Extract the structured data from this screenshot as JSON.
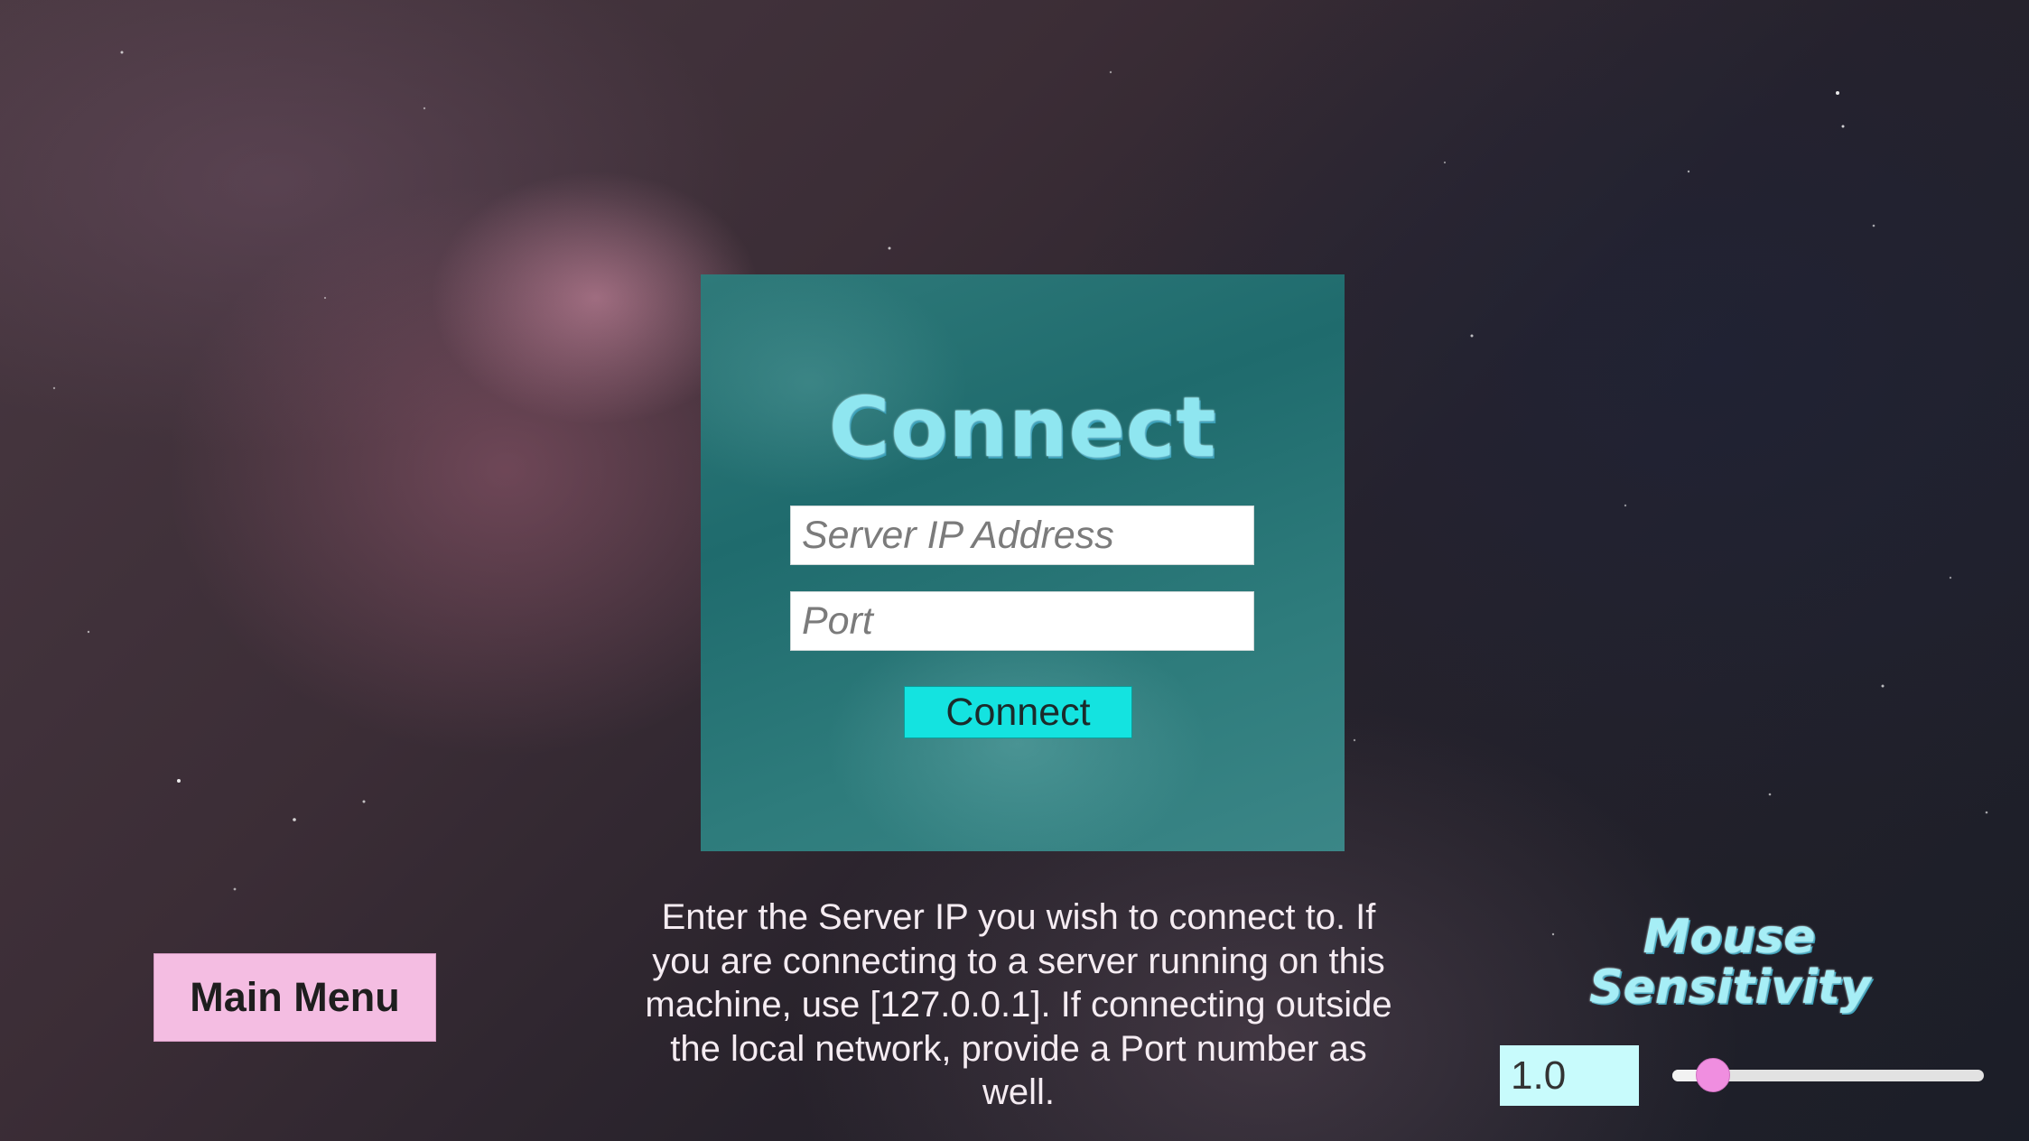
{
  "connect_panel": {
    "title": "Connect",
    "ip_placeholder": "Server IP Address",
    "port_placeholder": "Port",
    "connect_button_label": "Connect"
  },
  "main_menu_button_label": "Main Menu",
  "help_text": "Enter the Server IP you wish to connect to. If you are connecting to a server running on this machine, use [127.0.0.1]. If connecting outside the local network, provide a Port number as well.",
  "mouse_sensitivity": {
    "title_line1": "Mouse",
    "title_line2": "Sensitivity",
    "value": "1.0",
    "slider_fraction": 0.13
  },
  "colors": {
    "panel": "#2a7778",
    "connect_button": "#14e3e0",
    "main_menu_button": "#f4bde2",
    "title_text": "#8fe6f0",
    "slider_knob": "#f08ee0",
    "sensitivity_field": "#c8fbfc"
  }
}
